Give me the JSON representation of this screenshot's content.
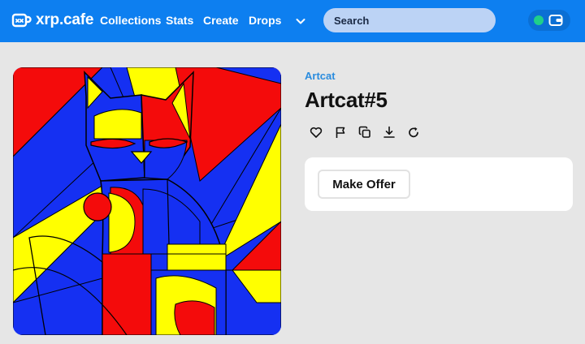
{
  "header": {
    "brand": {
      "name": "xrp.cafe",
      "icon": "cafe-cup-logo-icon"
    },
    "nav": [
      "Collections",
      "Stats",
      "Create",
      "Drops"
    ],
    "more_icon": "chevron-down-icon",
    "search": {
      "placeholder": "Search",
      "value": ""
    },
    "wallet": {
      "status_color": "#1fcf8a",
      "icon": "wallet-icon"
    },
    "colors": {
      "bar": "#0d7ff0",
      "search_bg": "#bcd3f5",
      "wallet_bg": "#0b6fd4"
    }
  },
  "nft": {
    "collection": "Artcat",
    "title": "Artcat#5",
    "actions": [
      "heart-icon",
      "flag-icon",
      "copy-icon",
      "download-icon",
      "refresh-icon"
    ],
    "artwork_colors": {
      "red": "#f40b0b",
      "yellow": "#ffff00",
      "blue": "#1530f2",
      "outline": "#000000"
    }
  },
  "offer": {
    "button_label": "Make Offer"
  },
  "page": {
    "background": "#e6e6e6",
    "link_color": "#2a8cde"
  }
}
